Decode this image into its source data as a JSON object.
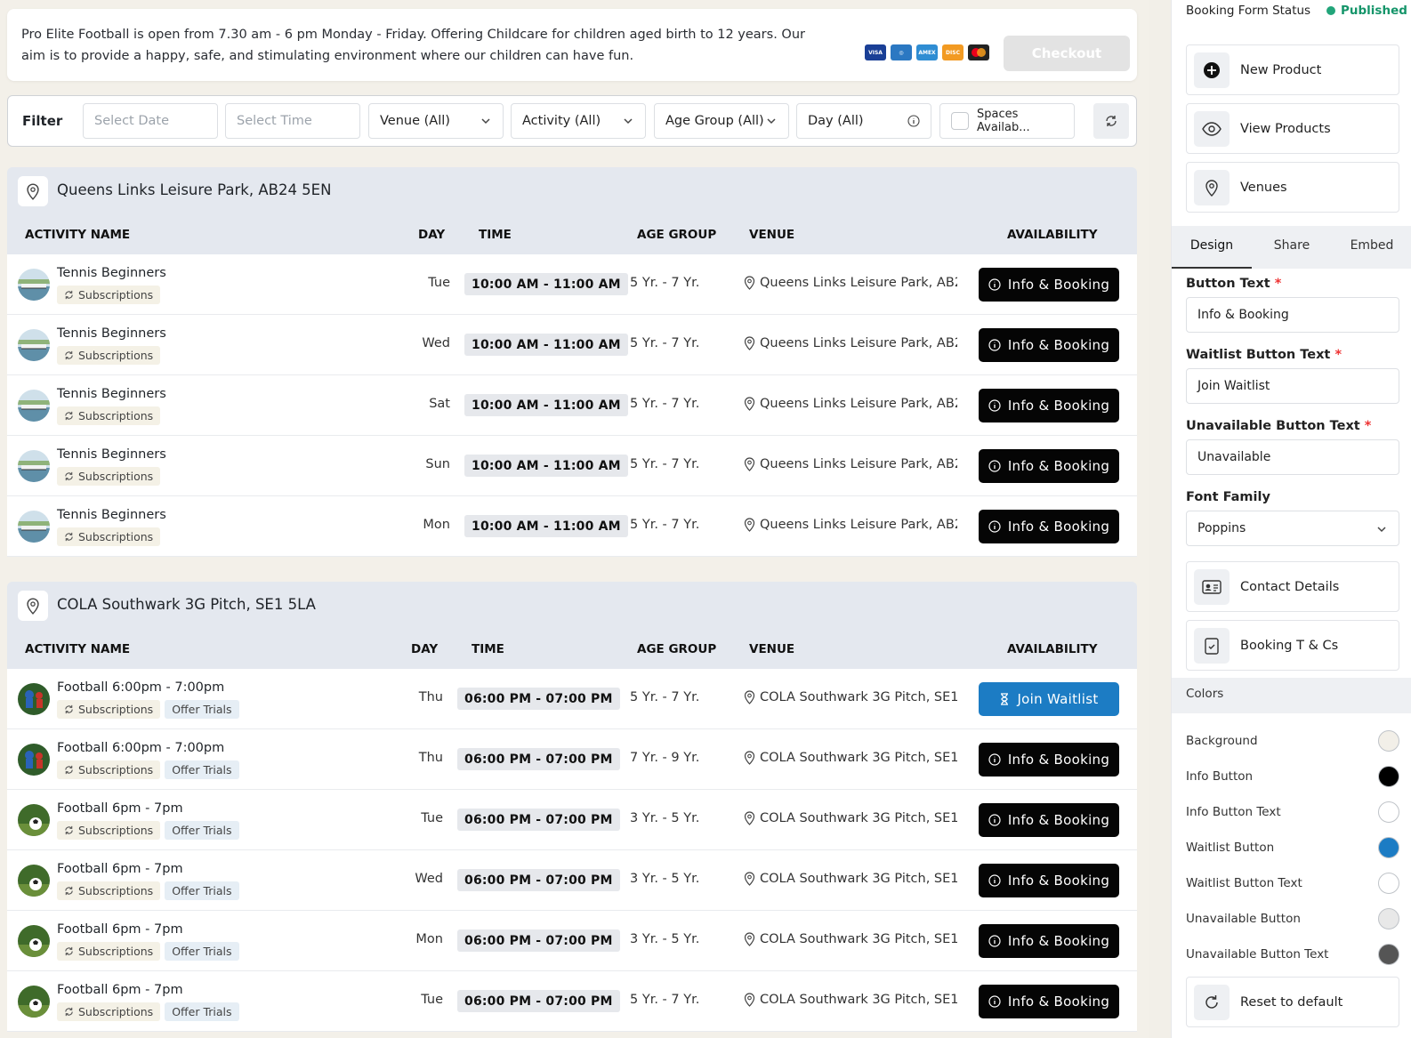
{
  "info": {
    "text": "Pro Elite Football is open from 7.30 am - 6 pm Monday - Friday. Offering Childcare for children aged birth to 12 years. Our aim is to provide a happy, safe, and stimulating environment where our children can have fun.",
    "checkout_label": "Checkout"
  },
  "filter": {
    "label": "Filter",
    "date_placeholder": "Select Date",
    "time_placeholder": "Select Time",
    "venue": "Venue (All)",
    "activity": "Activity (All)",
    "age_group": "Age Group (All)",
    "day": "Day (All)",
    "spaces": "Spaces Availab..."
  },
  "columns": {
    "activity": "ACTIVITY NAME",
    "day": "DAY",
    "time": "TIME",
    "age": "AGE GROUP",
    "venue": "VENUE",
    "availability": "AVAILABILITY"
  },
  "venues": [
    {
      "name": "Queens Links Leisure Park, AB24 5EN",
      "rows": [
        {
          "activity": "Tennis Beginners",
          "tags": [
            "Subscriptions"
          ],
          "day": "Tue",
          "time": "10:00 AM - 11:00 AM",
          "age": "5 Yr. - 7 Yr.",
          "venue": "Queens Links Leisure Park, AB2...",
          "button": "Info & Booking"
        },
        {
          "activity": "Tennis Beginners",
          "tags": [
            "Subscriptions"
          ],
          "day": "Wed",
          "time": "10:00 AM - 11:00 AM",
          "age": "5 Yr. - 7 Yr.",
          "venue": "Queens Links Leisure Park, AB2...",
          "button": "Info & Booking"
        },
        {
          "activity": "Tennis Beginners",
          "tags": [
            "Subscriptions"
          ],
          "day": "Sat",
          "time": "10:00 AM - 11:00 AM",
          "age": "5 Yr. - 7 Yr.",
          "venue": "Queens Links Leisure Park, AB2...",
          "button": "Info & Booking"
        },
        {
          "activity": "Tennis Beginners",
          "tags": [
            "Subscriptions"
          ],
          "day": "Sun",
          "time": "10:00 AM - 11:00 AM",
          "age": "5 Yr. - 7 Yr.",
          "venue": "Queens Links Leisure Park, AB2...",
          "button": "Info & Booking"
        },
        {
          "activity": "Tennis Beginners",
          "tags": [
            "Subscriptions"
          ],
          "day": "Mon",
          "time": "10:00 AM - 11:00 AM",
          "age": "5 Yr. - 7 Yr.",
          "venue": "Queens Links Leisure Park, AB2...",
          "button": "Info & Booking"
        }
      ]
    },
    {
      "name": "COLA Southwark 3G Pitch, SE1 5LA",
      "rows": [
        {
          "activity": "Football 6:00pm - 7:00pm",
          "tags": [
            "Subscriptions",
            "Offer Trials"
          ],
          "day": "Thu",
          "time": "06:00 PM - 07:00 PM",
          "age": "5 Yr. - 7 Yr.",
          "venue": "COLA Southwark 3G Pitch, SE1 ...",
          "button": "Join Waitlist"
        },
        {
          "activity": "Football 6:00pm - 7:00pm",
          "tags": [
            "Subscriptions",
            "Offer Trials"
          ],
          "day": "Thu",
          "time": "06:00 PM - 07:00 PM",
          "age": "7 Yr. - 9 Yr.",
          "venue": "COLA Southwark 3G Pitch, SE1 ...",
          "button": "Info & Booking"
        },
        {
          "activity": "Football 6pm - 7pm",
          "tags": [
            "Subscriptions",
            "Offer Trials"
          ],
          "day": "Tue",
          "time": "06:00 PM - 07:00 PM",
          "age": "3 Yr. - 5 Yr.",
          "venue": "COLA Southwark 3G Pitch, SE1 ...",
          "button": "Info & Booking"
        },
        {
          "activity": "Football 6pm - 7pm",
          "tags": [
            "Subscriptions",
            "Offer Trials"
          ],
          "day": "Wed",
          "time": "06:00 PM - 07:00 PM",
          "age": "3 Yr. - 5 Yr.",
          "venue": "COLA Southwark 3G Pitch, SE1 ...",
          "button": "Info & Booking"
        },
        {
          "activity": "Football 6pm - 7pm",
          "tags": [
            "Subscriptions",
            "Offer Trials"
          ],
          "day": "Mon",
          "time": "06:00 PM - 07:00 PM",
          "age": "3 Yr. - 5 Yr.",
          "venue": "COLA Southwark 3G Pitch, SE1 ...",
          "button": "Info & Booking"
        },
        {
          "activity": "Football 6pm - 7pm",
          "tags": [
            "Subscriptions",
            "Offer Trials"
          ],
          "day": "Tue",
          "time": "06:00 PM - 07:00 PM",
          "age": "5 Yr. - 7 Yr.",
          "venue": "COLA Southwark 3G Pitch, SE1 ...",
          "button": "Info & Booking"
        }
      ]
    }
  ],
  "sidebar": {
    "status_label": "Booking Form Status",
    "status_value": "Published",
    "new_product": "New Product",
    "view_products": "View Products",
    "venues": "Venues",
    "tabs": [
      "Design",
      "Share",
      "Embed"
    ],
    "button_text_label": "Button Text",
    "button_text_value": "Info & Booking",
    "waitlist_label": "Waitlist Button Text",
    "waitlist_value": "Join Waitlist",
    "unavailable_label": "Unavailable Button Text",
    "unavailable_value": "Unavailable",
    "font_label": "Font Family",
    "font_value": "Poppins",
    "contact_details": "Contact Details",
    "booking_tcs": "Booking T & Cs",
    "colors_head": "Colors",
    "colors": [
      {
        "label": "Background",
        "color": "#f2efe8"
      },
      {
        "label": "Info Button",
        "color": "#000000"
      },
      {
        "label": "Info Button Text",
        "color": "#ffffff"
      },
      {
        "label": "Waitlist Button",
        "color": "#1c7cc4"
      },
      {
        "label": "Waitlist Button Text",
        "color": "#ffffff"
      },
      {
        "label": "Unavailable Button",
        "color": "#e8e8e8"
      },
      {
        "label": "Unavailable Button Text",
        "color": "#555555"
      }
    ],
    "reset": "Reset to default"
  }
}
